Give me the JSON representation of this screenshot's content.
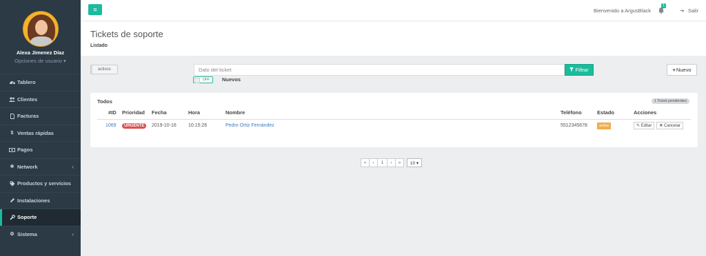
{
  "sidebar": {
    "user_name": "Alexa Jimenez Díaz",
    "user_options": "Opciones de usuario ▾",
    "items": [
      {
        "label": "Tablero",
        "icon": "dashboard-icon"
      },
      {
        "label": "Clientes",
        "icon": "users-icon"
      },
      {
        "label": "Facturas",
        "icon": "file-icon"
      },
      {
        "label": "Ventas rápidas",
        "icon": "dollar-icon"
      },
      {
        "label": "Pagos",
        "icon": "money-icon"
      },
      {
        "label": "Network",
        "icon": "snowflake-icon"
      },
      {
        "label": "Productos y servicios",
        "icon": "tags-icon"
      },
      {
        "label": "Instalaciones",
        "icon": "pencil-icon"
      },
      {
        "label": "Soporte",
        "icon": "wrench-icon"
      },
      {
        "label": "Sistema",
        "icon": "cogs-icon"
      }
    ],
    "active_index": 8,
    "accent_color": "#1abc9c"
  },
  "topbar": {
    "welcome": "Bienvenido a ArgusBlack",
    "notification_count": "1",
    "logout_label": "Salir"
  },
  "header": {
    "title": "Tickets de soporte",
    "subtitle": "Listado"
  },
  "filters": {
    "status_toggle": "activos",
    "search_placeholder": "Dato del ticket",
    "filter_button": "Filtrar",
    "new_button": "Nuevo",
    "switch_state": "OFF",
    "switch_label": "Nuevos"
  },
  "panel": {
    "title": "Todos",
    "pending_badge": "1 Ticket pendientes",
    "columns": [
      "#ID",
      "Prioridad",
      "Fecha",
      "Hora",
      "Nombre",
      "Teléfono",
      "Estado",
      "Acciones"
    ],
    "rows": [
      {
        "id": "1069",
        "priority": "URGENTE",
        "date": "2019-10-16",
        "time": "10:15:26",
        "name": "Pedro Ortiz Fernández",
        "phone": "5512345678",
        "status": "active",
        "edit_label": "Editar",
        "cancel_label": "Cancelar"
      }
    ]
  },
  "pagination": {
    "first": "«",
    "prev": "‹",
    "page": "1",
    "next": "›",
    "last": "»",
    "per_page": "10 ▾"
  }
}
